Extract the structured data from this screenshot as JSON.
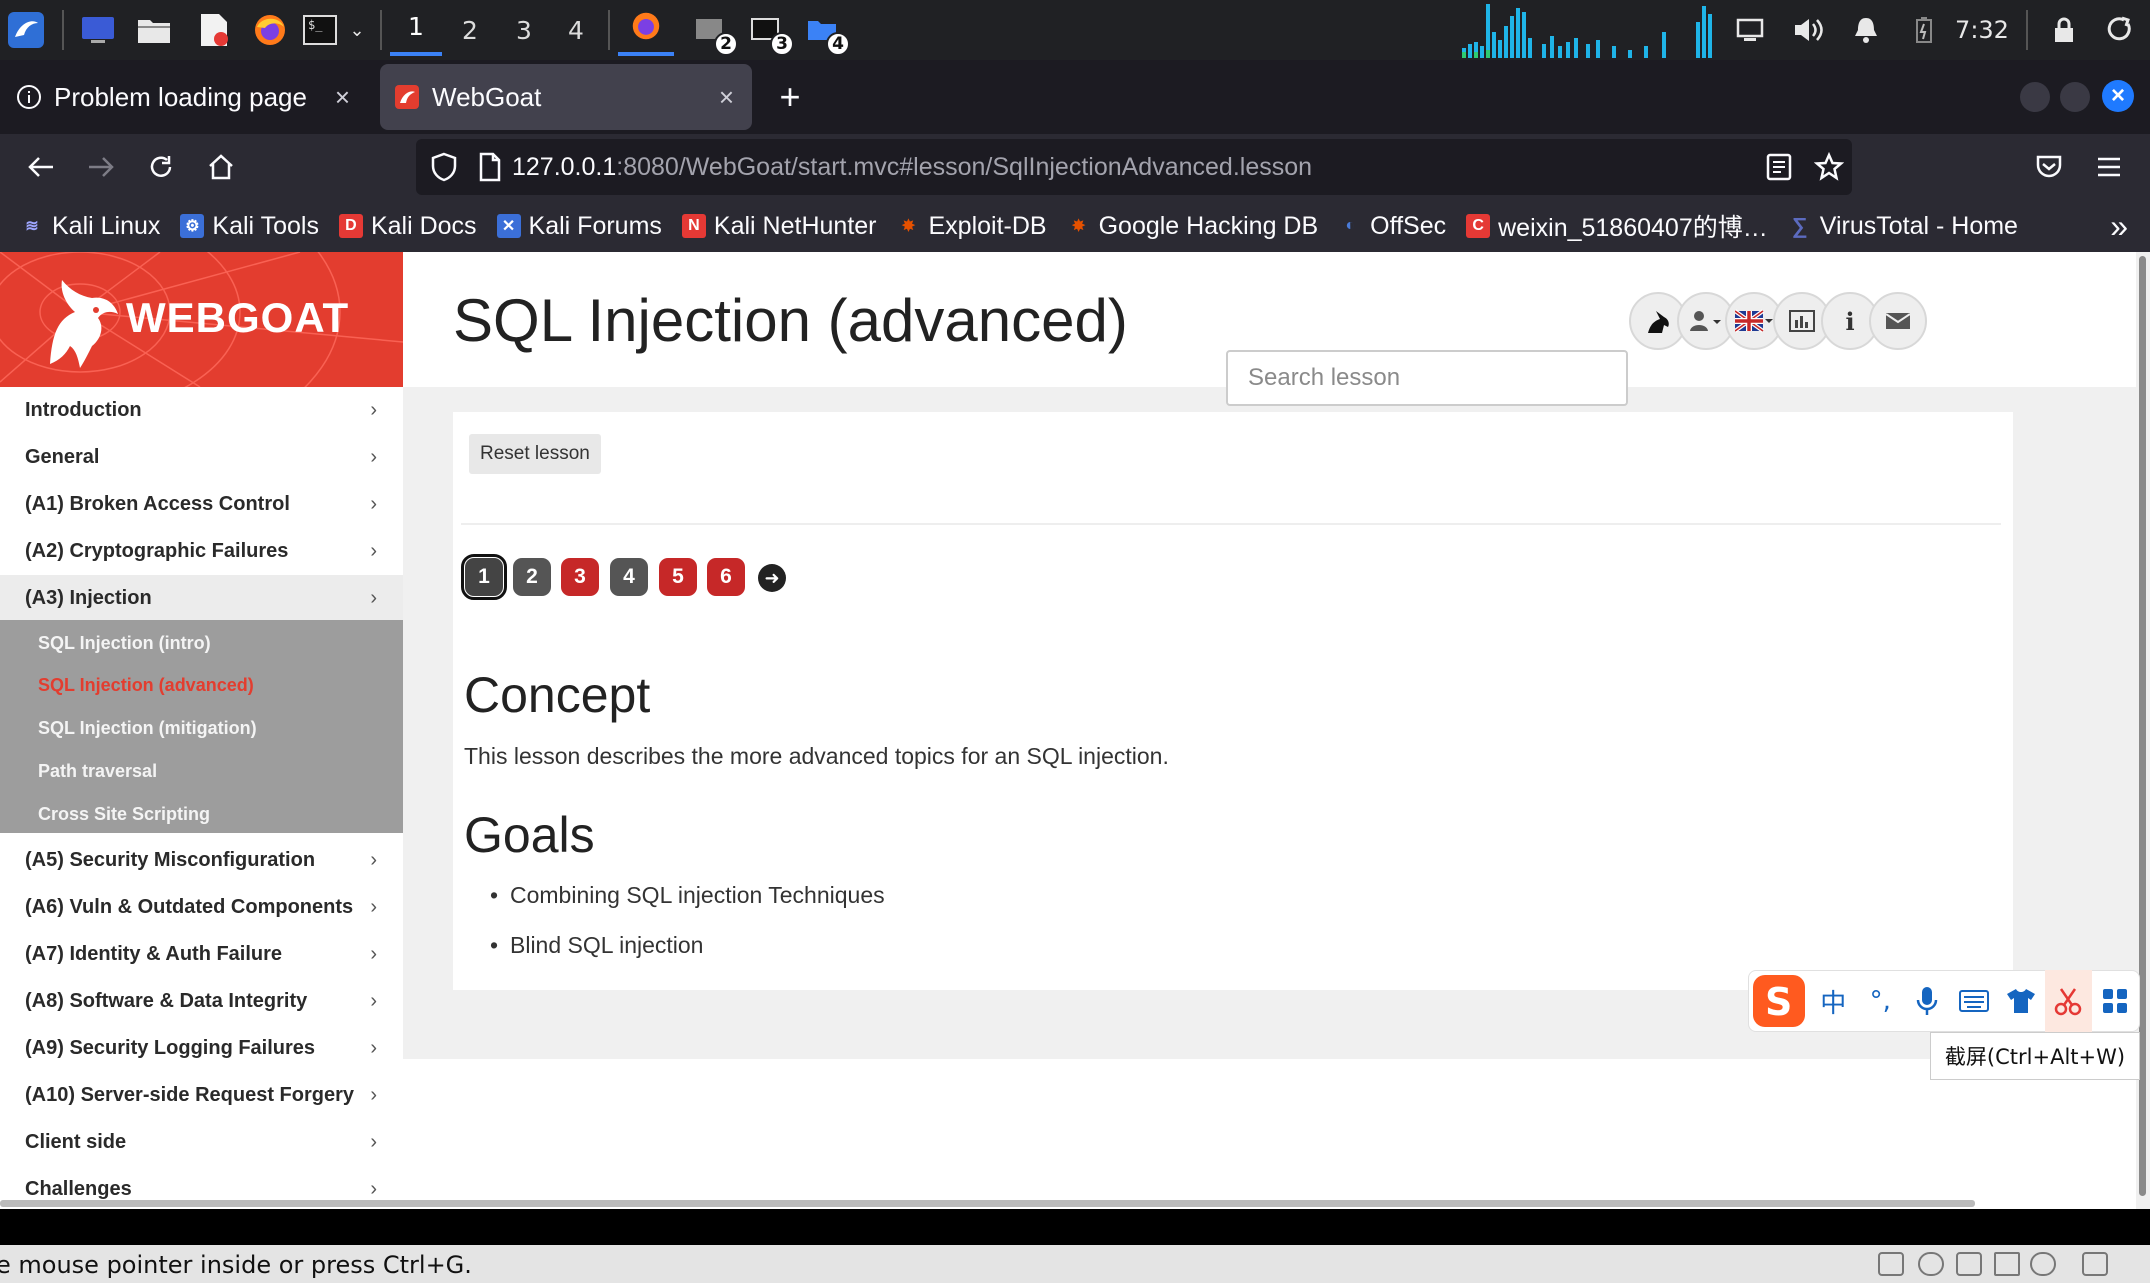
{
  "system_panel": {
    "workspaces": [
      "1",
      "2",
      "3",
      "4"
    ],
    "active_workspace": "1",
    "window_badges": [
      "2",
      "3",
      "4"
    ],
    "clock": "7:32",
    "icons": [
      "kali-menu-icon",
      "desktop-icon",
      "files-icon",
      "text-editor-icon",
      "firefox-icon",
      "terminal-icon",
      "volume-icon",
      "notification-bell-icon",
      "battery-icon",
      "lock-icon",
      "power-icon"
    ]
  },
  "browser": {
    "tabs": [
      {
        "label": "Problem loading page",
        "close": "×",
        "active": false
      },
      {
        "label": "WebGoat",
        "close": "×",
        "active": true
      }
    ],
    "new_tab": "+",
    "url_host": "127.0.0.1",
    "url_rest": ":8080/WebGoat/start.mvc#lesson/SqlInjectionAdvanced.lesson",
    "bookmarks": [
      {
        "label": "Kali Linux",
        "icon": "kali-icon",
        "color": "#6b7cff"
      },
      {
        "label": "Kali Tools",
        "icon": "kali-tools-icon",
        "color": "#3b6fd8"
      },
      {
        "label": "Kali Docs",
        "icon": "kali-docs-icon",
        "color": "#e53935"
      },
      {
        "label": "Kali Forums",
        "icon": "kali-forums-icon",
        "color": "#3b6fd8"
      },
      {
        "label": "Kali NetHunter",
        "icon": "nethunter-icon",
        "color": "#e53935"
      },
      {
        "label": "Exploit-DB",
        "icon": "exploit-db-icon",
        "color": "#e65100"
      },
      {
        "label": "Google Hacking DB",
        "icon": "ghdb-icon",
        "color": "#e65100"
      },
      {
        "label": "OffSec",
        "icon": "offsec-icon",
        "color": "#4a7bd8"
      },
      {
        "label": "weixin_51860407的博…",
        "icon": "csdn-icon",
        "color": "#e53935"
      },
      {
        "label": "VirusTotal - Home",
        "icon": "virustotal-icon",
        "color": "#3949ab"
      }
    ],
    "more": "»"
  },
  "webgoat": {
    "logo": "WEBGOAT",
    "brand_color": "#e33d2f",
    "lesson_title": "SQL Injection (advanced)",
    "search_placeholder": "Search lesson",
    "header_buttons": [
      "home-goat-icon",
      "user-menu-icon",
      "language-uk-flag-icon",
      "report-card-icon",
      "about-info-icon",
      "contact-mail-icon"
    ],
    "sidebar": {
      "categories_top": [
        {
          "label": "Introduction",
          "chev": "›"
        },
        {
          "label": "General",
          "chev": "›"
        },
        {
          "label": "(A1) Broken Access Control",
          "chev": "›"
        },
        {
          "label": "(A2) Cryptographic Failures",
          "chev": "›"
        },
        {
          "label": "(A3) Injection",
          "chev": "›"
        }
      ],
      "injection_lessons": [
        {
          "label": "SQL Injection (intro)",
          "active": false
        },
        {
          "label": "SQL Injection (advanced)",
          "active": true
        },
        {
          "label": "SQL Injection (mitigation)",
          "active": false
        },
        {
          "label": "Path traversal",
          "active": false
        },
        {
          "label": "Cross Site Scripting",
          "active": false
        }
      ],
      "categories_bottom": [
        {
          "label": "(A5) Security Misconfiguration",
          "chev": "›"
        },
        {
          "label": "(A6) Vuln & Outdated Components",
          "chev": "›"
        },
        {
          "label": "(A7) Identity & Auth Failure",
          "chev": "›"
        },
        {
          "label": "(A8) Software & Data Integrity",
          "chev": "›"
        },
        {
          "label": "(A9) Security Logging Failures",
          "chev": "›"
        },
        {
          "label": "(A10) Server-side Request Forgery",
          "chev": "›"
        },
        {
          "label": "Client side",
          "chev": "›"
        },
        {
          "label": "Challenges",
          "chev": "›"
        }
      ]
    },
    "reset_label": "Reset lesson",
    "pages": [
      {
        "label": "1",
        "state": "current"
      },
      {
        "label": "2",
        "state": "dark"
      },
      {
        "label": "3",
        "state": "red"
      },
      {
        "label": "4",
        "state": "dark"
      },
      {
        "label": "5",
        "state": "red"
      },
      {
        "label": "6",
        "state": "red"
      }
    ],
    "next_page": "➜",
    "concept_heading": "Concept",
    "concept_text": "This lesson describes the more advanced topics for an SQL injection.",
    "goals_heading": "Goals",
    "goals": [
      "Combining SQL injection Techniques",
      "Blind SQL injection"
    ]
  },
  "ime": {
    "chinese_mode": "中",
    "punct": "°,",
    "tooltip": "截屏(Ctrl+Alt+W)"
  },
  "status_bar": {
    "text": "e mouse pointer inside or press Ctrl+G."
  }
}
